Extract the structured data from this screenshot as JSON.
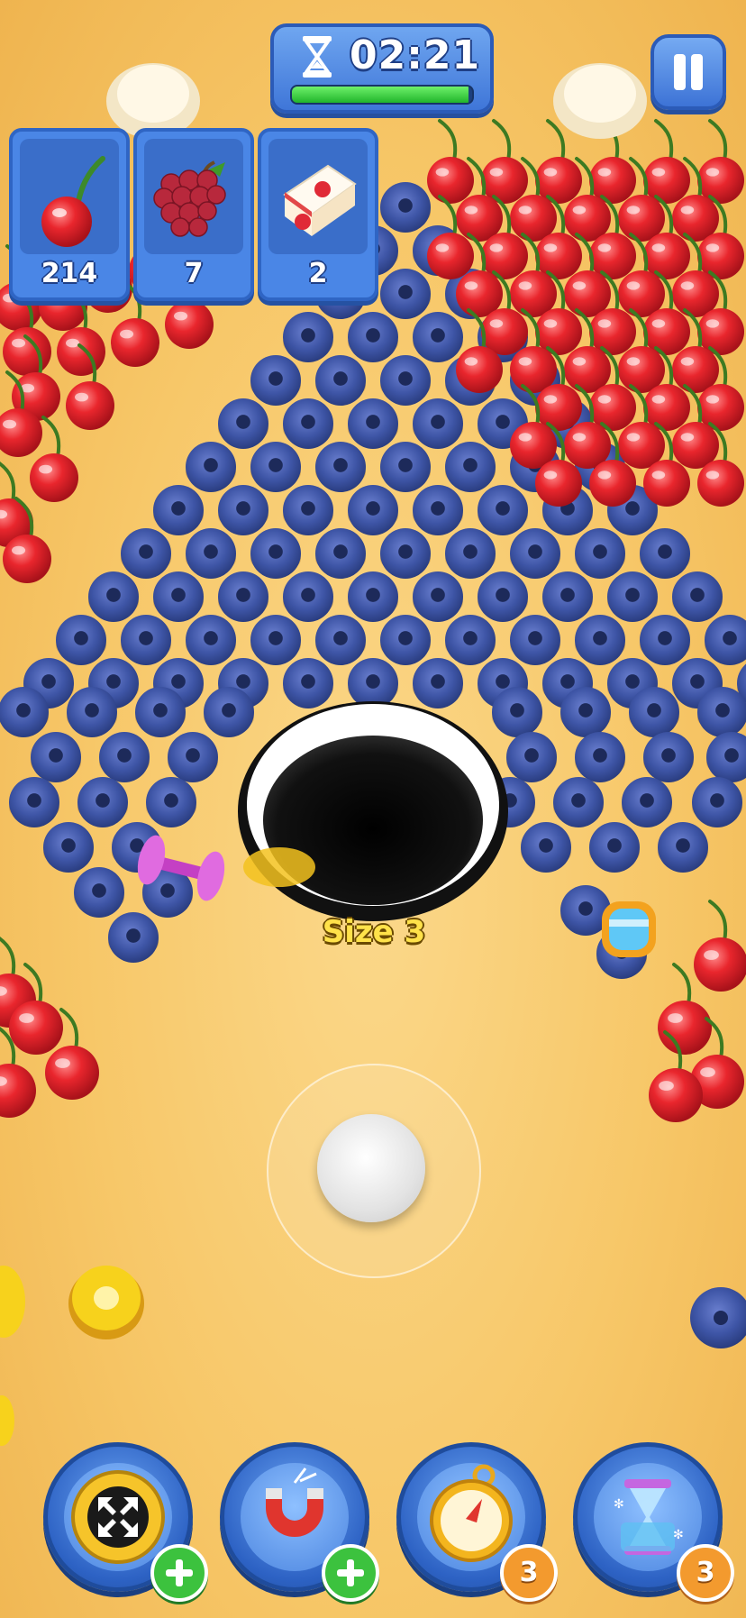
{
  "hud": {
    "timer": "02:21",
    "timer_icon": "hourglass-icon",
    "timer_progress": 0.98,
    "pause_icon": "pause-icon"
  },
  "goals": [
    {
      "item": "cherry",
      "icon": "cherry-icon",
      "count": "214"
    },
    {
      "item": "grapes",
      "icon": "grapes-icon",
      "count": "7"
    },
    {
      "item": "strawberry cake",
      "icon": "cake-icon",
      "count": "2"
    }
  ],
  "player": {
    "size_label": "Size 3"
  },
  "boosters": [
    {
      "name": "expand",
      "icon": "expand-arrows-icon",
      "indicator": "plus"
    },
    {
      "name": "magnet",
      "icon": "magnet-icon",
      "indicator": "plus"
    },
    {
      "name": "compass",
      "icon": "compass-icon",
      "indicator": "count",
      "count": "3"
    },
    {
      "name": "time freeze",
      "icon": "hourglass-freeze-icon",
      "indicator": "count",
      "count": "3"
    }
  ],
  "colors": {
    "ground": "#f7c768",
    "hud_blue": "#4a86e6",
    "blueberry": "#3e5aa8",
    "cherry": "#e3232b",
    "timer_bar": "#21b52b"
  }
}
